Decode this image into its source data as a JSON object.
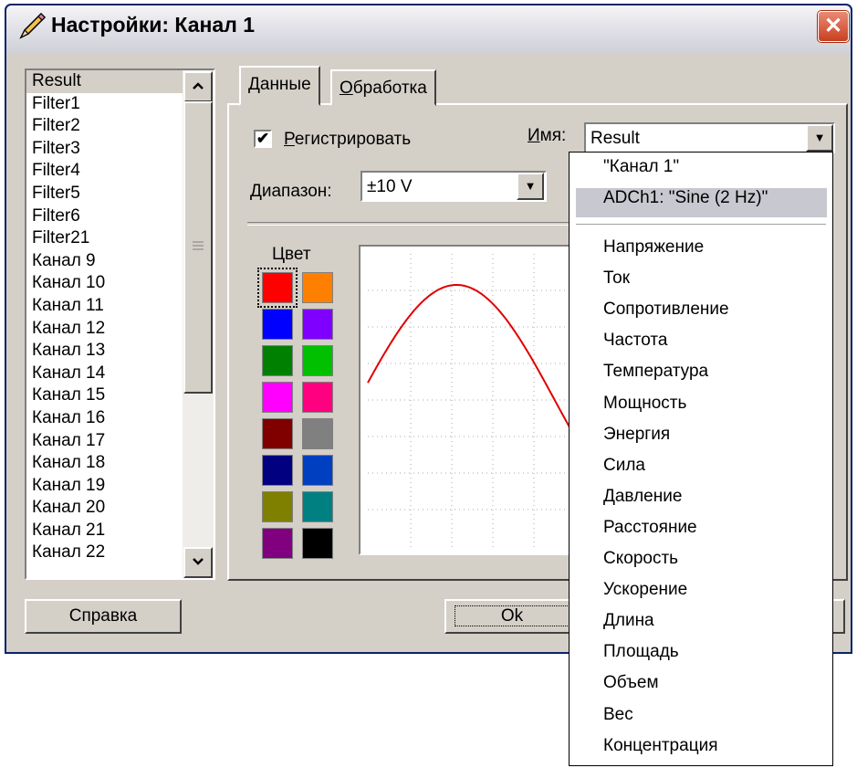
{
  "window": {
    "title": "Настройки: Канал 1",
    "close_label": "✕"
  },
  "channels": {
    "items": [
      "Result",
      "Filter1",
      "Filter2",
      "Filter3",
      "Filter4",
      "Filter5",
      "Filter6",
      "Filter21",
      "Канал 9",
      "Канал 10",
      "Канал 11",
      "Канал 12",
      "Канал 13",
      "Канал 14",
      "Канал 15",
      "Канал 16",
      "Канал 17",
      "Канал 18",
      "Канал 19",
      "Канал 20",
      "Канал 21",
      "Канал 22"
    ],
    "selected": "Result"
  },
  "tabs": [
    {
      "label_prefix": "",
      "label_underline": "Д",
      "label_rest": "анные",
      "active": true
    },
    {
      "label_prefix": "",
      "label_underline": "О",
      "label_rest": "бработка",
      "active": false
    }
  ],
  "data_tab": {
    "register_checked": true,
    "register_label_underline": "Р",
    "register_label_rest": "егистрировать",
    "name_label_underline": "И",
    "name_label_rest": "мя:",
    "name_value": "Result",
    "range_label_underline": "Д",
    "range_label_rest": "иапазон:",
    "range_value": "±10 V",
    "color_label": "Цвет"
  },
  "colors": [
    "#ff0000",
    "#ff8000",
    "#0000ff",
    "#8000ff",
    "#008000",
    "#00c000",
    "#ff00ff",
    "#ff0080",
    "#800000",
    "#808080",
    "#000080",
    "#0040c0",
    "#808000",
    "#008080",
    "#800080",
    "#000000"
  ],
  "selected_color": "#ff0000",
  "chart": {
    "line_color": "#e00000"
  },
  "buttons": {
    "help": "Справка",
    "ok": "Ok"
  },
  "dropdown": {
    "items": [
      "\"Канал 1\"",
      "ADCh1: \"Sine (2 Hz)\""
    ],
    "highlighted_index": 1,
    "units": [
      "Напряжение",
      "Ток",
      "Сопротивление",
      "Частота",
      "Температура",
      "Мощность",
      "Энергия",
      "Сила",
      "Давление",
      "Расстояние",
      "Скорость",
      "Ускорение",
      "Длина",
      "Площадь",
      "Объем",
      "Вес",
      "Концентрация"
    ]
  }
}
